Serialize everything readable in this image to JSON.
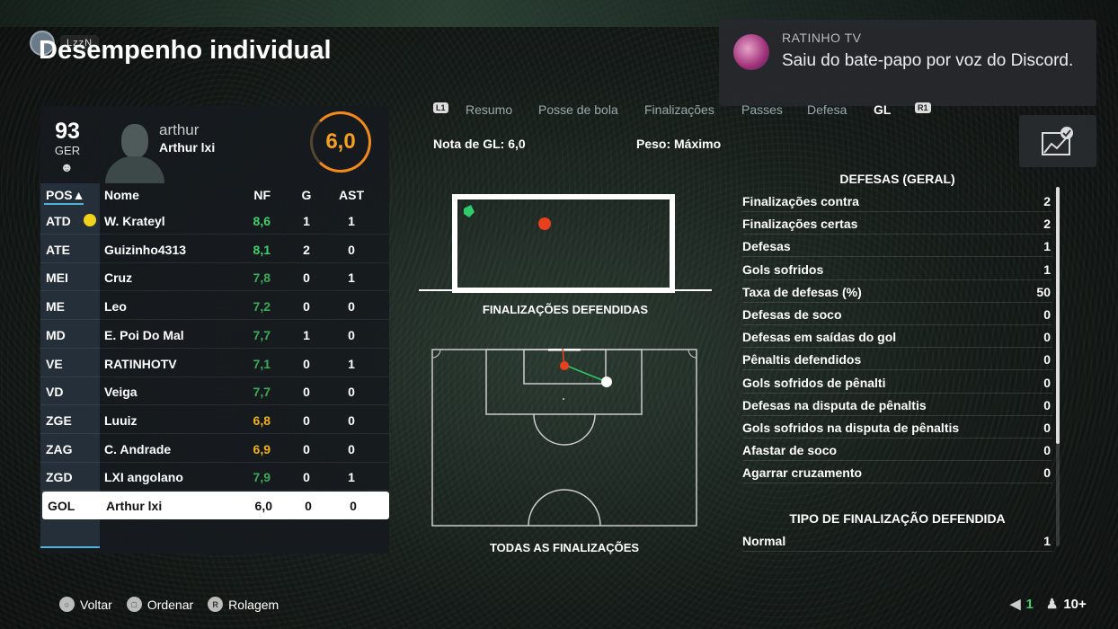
{
  "header": {
    "title": "Desempenho individual",
    "user_tag": "LzzN"
  },
  "toast": {
    "sender": "RATINHO TV",
    "message": "Saiu do bate-papo por voz do Discord."
  },
  "player": {
    "overall": "93",
    "nation": "GER",
    "gamertag": "arthur",
    "name": "Arthur lxi",
    "match_rating": "6,0"
  },
  "table": {
    "headers": {
      "pos": "POS▲",
      "name": "Nome",
      "nf": "NF",
      "g": "G",
      "ast": "AST"
    },
    "rows": [
      {
        "pos": "ATD",
        "name": "W. Krateyl",
        "nf": "8,6",
        "g": "1",
        "ast": "1",
        "nf_color": "#3fd16a",
        "motm": true
      },
      {
        "pos": "ATE",
        "name": "Guizinho4313",
        "nf": "8,1",
        "g": "2",
        "ast": "0",
        "nf_color": "#3fd16a"
      },
      {
        "pos": "MEI",
        "name": "Cruz",
        "nf": "7,8",
        "g": "0",
        "ast": "1",
        "nf_color": "#3caa58"
      },
      {
        "pos": "ME",
        "name": "Leo",
        "nf": "7,2",
        "g": "0",
        "ast": "0",
        "nf_color": "#3caa58"
      },
      {
        "pos": "MD",
        "name": "E. Poi Do Mal",
        "nf": "7,7",
        "g": "1",
        "ast": "0",
        "nf_color": "#3caa58"
      },
      {
        "pos": "VE",
        "name": "RATINHOTV",
        "nf": "7,1",
        "g": "0",
        "ast": "1",
        "nf_color": "#3caa58"
      },
      {
        "pos": "VD",
        "name": "Veiga",
        "nf": "7,7",
        "g": "0",
        "ast": "0",
        "nf_color": "#3caa58"
      },
      {
        "pos": "ZGE",
        "name": "Luuiz",
        "nf": "6,8",
        "g": "0",
        "ast": "0",
        "nf_color": "#f2b01c"
      },
      {
        "pos": "ZAG",
        "name": "C. Andrade",
        "nf": "6,9",
        "g": "0",
        "ast": "0",
        "nf_color": "#f2b01c"
      },
      {
        "pos": "ZGD",
        "name": "LXI angolano",
        "nf": "7,9",
        "g": "0",
        "ast": "1",
        "nf_color": "#3caa58"
      },
      {
        "pos": "GOL",
        "name": "Arthur lxi",
        "nf": "6,0",
        "g": "0",
        "ast": "0",
        "nf_color": "#111111",
        "selected": true
      }
    ]
  },
  "tabs": {
    "l1": "L1",
    "r1": "R1",
    "items": [
      "Resumo",
      "Posse de bola",
      "Finalizações",
      "Passes",
      "Defesa",
      "GL"
    ],
    "active": "GL"
  },
  "summary": {
    "gl_note": "Nota de GL: 6,0",
    "peso": "Peso: Máximo"
  },
  "captions": {
    "defended": "FINALIZAÇÕES DEFENDIDAS",
    "all_shots": "TODAS AS FINALIZAÇÕES"
  },
  "stats": {
    "title": "DEFESAS (GERAL)",
    "rows": [
      {
        "label": "Finalizações contra",
        "value": "2"
      },
      {
        "label": "Finalizações certas",
        "value": "2"
      },
      {
        "label": "Defesas",
        "value": "1"
      },
      {
        "label": "Gols sofridos",
        "value": "1"
      },
      {
        "label": "Taxa de defesas (%)",
        "value": "50"
      },
      {
        "label": "Defesas de soco",
        "value": "0"
      },
      {
        "label": "Defesas em saídas do gol",
        "value": "0"
      },
      {
        "label": "Pênaltis defendidos",
        "value": "0"
      },
      {
        "label": "Gols sofridos de pênalti",
        "value": "0"
      },
      {
        "label": "Defesas na disputa de pênaltis",
        "value": "0"
      },
      {
        "label": "Gols sofridos na disputa de pênaltis",
        "value": "0"
      },
      {
        "label": "Afastar de soco",
        "value": "0"
      },
      {
        "label": "Agarrar cruzamento",
        "value": "0"
      }
    ],
    "type_title": "TIPO DE FINALIZAÇÃO DEFENDIDA",
    "type_rows": [
      {
        "label": "Normal",
        "value": "1"
      }
    ]
  },
  "footer": {
    "items": [
      {
        "icon": "circle-button-icon",
        "glyph": "○",
        "label": "Voltar"
      },
      {
        "icon": "square-button-icon",
        "glyph": "□",
        "label": "Ordenar"
      },
      {
        "icon": "right-stick-icon",
        "glyph": "R",
        "label": "Rolagem"
      }
    ],
    "voice_count": "1",
    "party_count": "10+"
  },
  "colors": {
    "accent": "#4fb3d9",
    "rating": "#f7a020",
    "shot_ball": "#e8401c",
    "save_glove": "#2ecc6a"
  }
}
